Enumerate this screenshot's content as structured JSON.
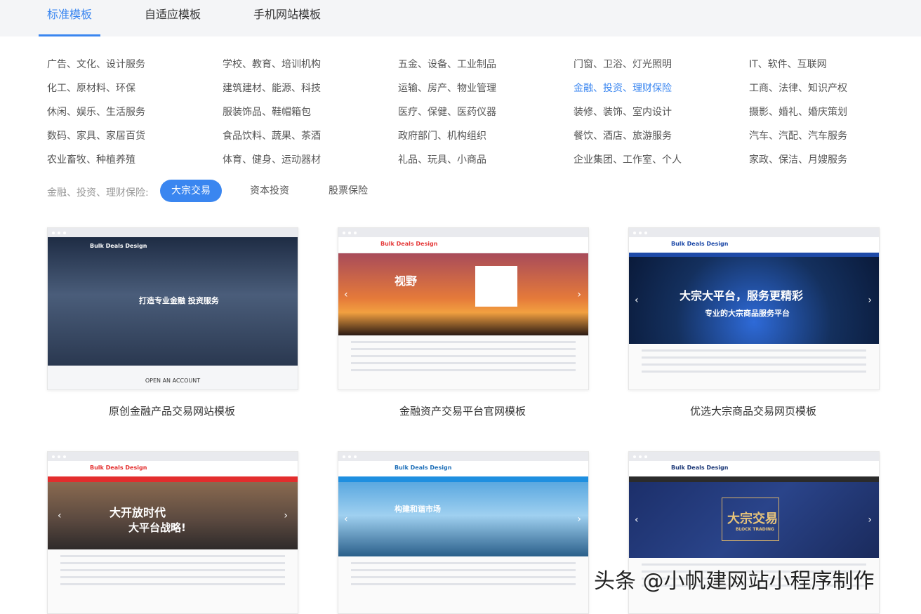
{
  "tabs": [
    "标准模板",
    "自适应模板",
    "手机网站模板"
  ],
  "categories": [
    [
      "广告、文化、设计服务",
      "学校、教育、培训机构",
      "五金、设备、工业制品",
      "门窗、卫浴、灯光照明",
      "IT、软件、互联网"
    ],
    [
      "化工、原材料、环保",
      "建筑建材、能源、科技",
      "运输、房产、物业管理",
      "金融、投资、理财保险",
      "工商、法律、知识产权"
    ],
    [
      "休闲、娱乐、生活服务",
      "服装饰品、鞋帽箱包",
      "医疗、保健、医药仪器",
      "装修、装饰、室内设计",
      "摄影、婚礼、婚庆策划"
    ],
    [
      "数码、家具、家居百货",
      "食品饮料、蔬果、茶酒",
      "政府部门、机构组织",
      "餐饮、酒店、旅游服务",
      "汽车、汽配、汽车服务"
    ],
    [
      "农业畜牧、种植养殖",
      "体育、健身、运动器材",
      "礼品、玩具、小商品",
      "企业集团、工作室、个人",
      "家政、保洁、月嫂服务"
    ]
  ],
  "filter": {
    "label": "金融、投资、理财保险:",
    "options": [
      "大宗交易",
      "资本投资",
      "股票保险"
    ]
  },
  "templates": [
    {
      "title": "原创金融产品交易网站模板",
      "logo": "Bulk Deals Design",
      "banner_text": "打造专业金融 投资服务",
      "footer_text": "OPEN AN ACCOUNT"
    },
    {
      "title": "金融资产交易平台官网模板",
      "logo": "Bulk Deals Design",
      "banner_text": "视野"
    },
    {
      "title": "优选大宗商品交易网页模板",
      "logo": "Bulk Deals Design",
      "banner_text": "大宗大平台，服务更精彩",
      "banner_sub": "专业的大宗商品服务平台"
    },
    {
      "title": "",
      "logo": "Bulk Deals Design",
      "banner_text": "大开放时代",
      "banner_sub": "大平台战略!"
    },
    {
      "title": "",
      "logo": "Bulk Deals Design",
      "banner_text": "构建和谐市场"
    },
    {
      "title": "",
      "logo": "Bulk Deals Design",
      "banner_text": "大宗交易",
      "banner_sub": "BLOCK TRADING"
    }
  ],
  "watermark": "头条 @小帆建网站小程序制作",
  "colors": {
    "accent": "#3a86f0"
  }
}
